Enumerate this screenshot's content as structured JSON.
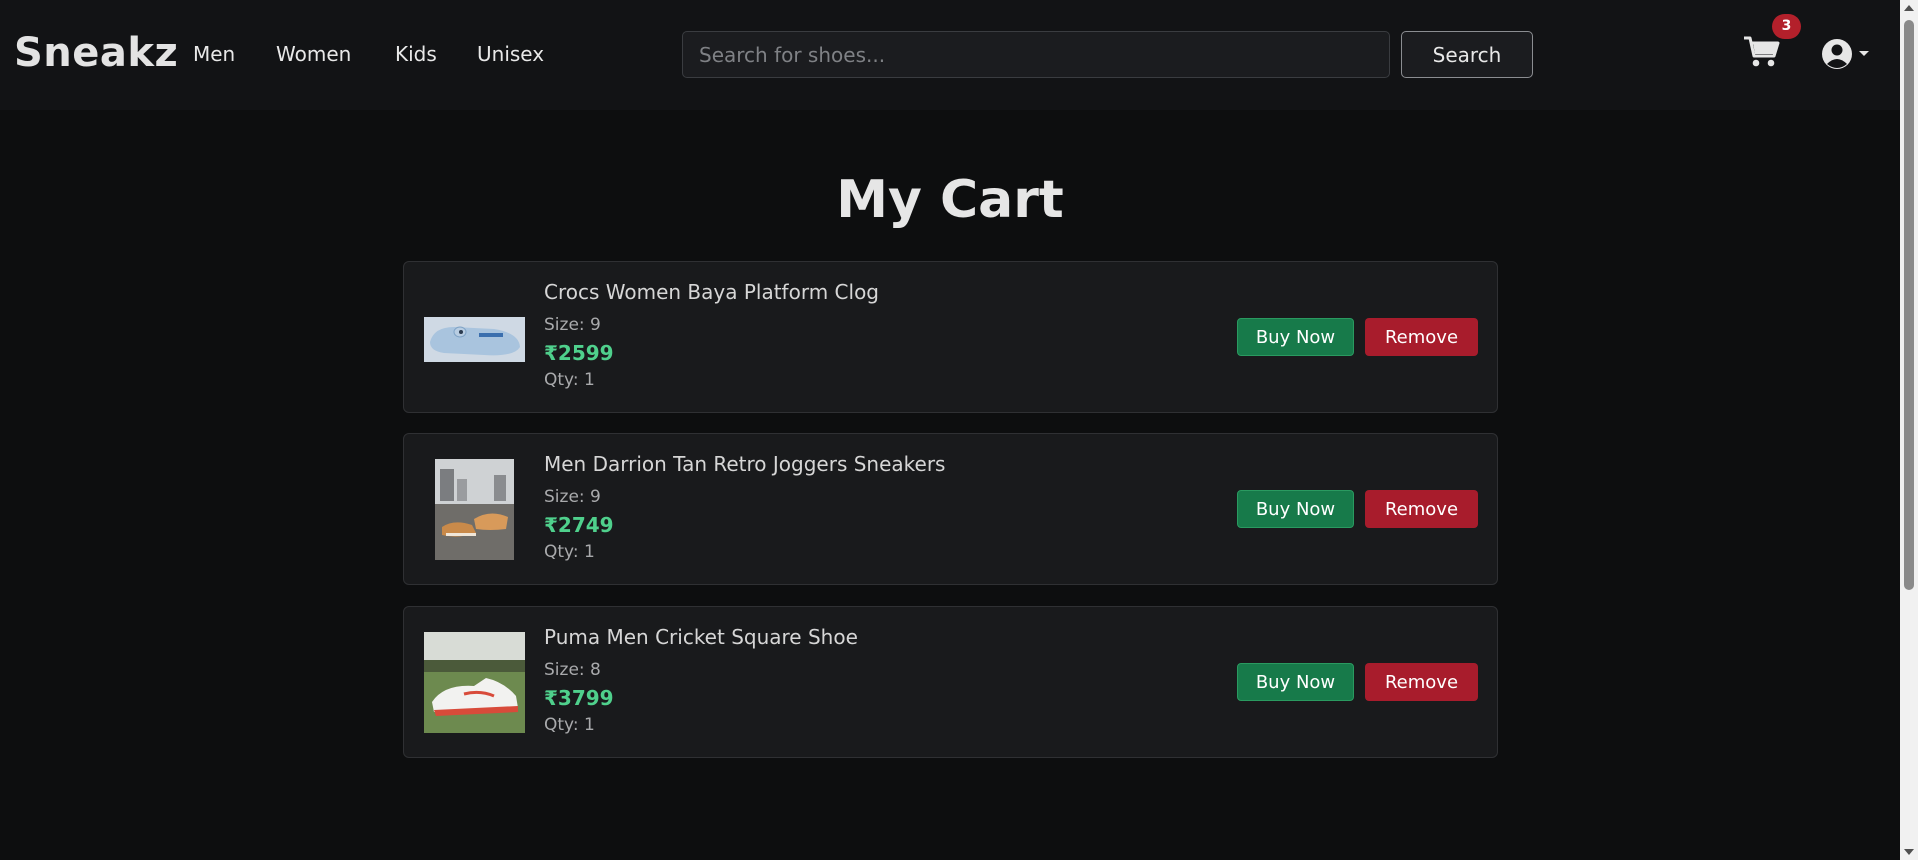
{
  "brand": "Sneakz",
  "nav": {
    "links": [
      "Men",
      "Women",
      "Kids",
      "Unisex"
    ]
  },
  "search": {
    "placeholder": "Search for shoes...",
    "value": "",
    "button_label": "Search"
  },
  "cart": {
    "icon": "shopping-cart-icon",
    "count": "3"
  },
  "user": {
    "icon": "user-circle-icon",
    "menu_icon": "caret-down-icon"
  },
  "page_title": "My Cart",
  "items": [
    {
      "name": "Crocs Women Baya Platform Clog",
      "size": "Size: 9",
      "price": "₹2599",
      "qty": "Qty: 1",
      "buy_label": "Buy Now",
      "remove_label": "Remove"
    },
    {
      "name": "Men Darrion Tan Retro Joggers Sneakers",
      "size": "Size: 9",
      "price": "₹2749",
      "qty": "Qty: 1",
      "buy_label": "Buy Now",
      "remove_label": "Remove"
    },
    {
      "name": "Puma Men Cricket Square Shoe",
      "size": "Size: 8",
      "price": "₹3799",
      "qty": "Qty: 1",
      "buy_label": "Buy Now",
      "remove_label": "Remove"
    }
  ],
  "colors": {
    "background": "#0d0e0f",
    "navbar": "#121315",
    "price": "#4fd08c",
    "buy": "#177a4a",
    "remove": "#a81c2c",
    "badge": "#b3202b"
  }
}
